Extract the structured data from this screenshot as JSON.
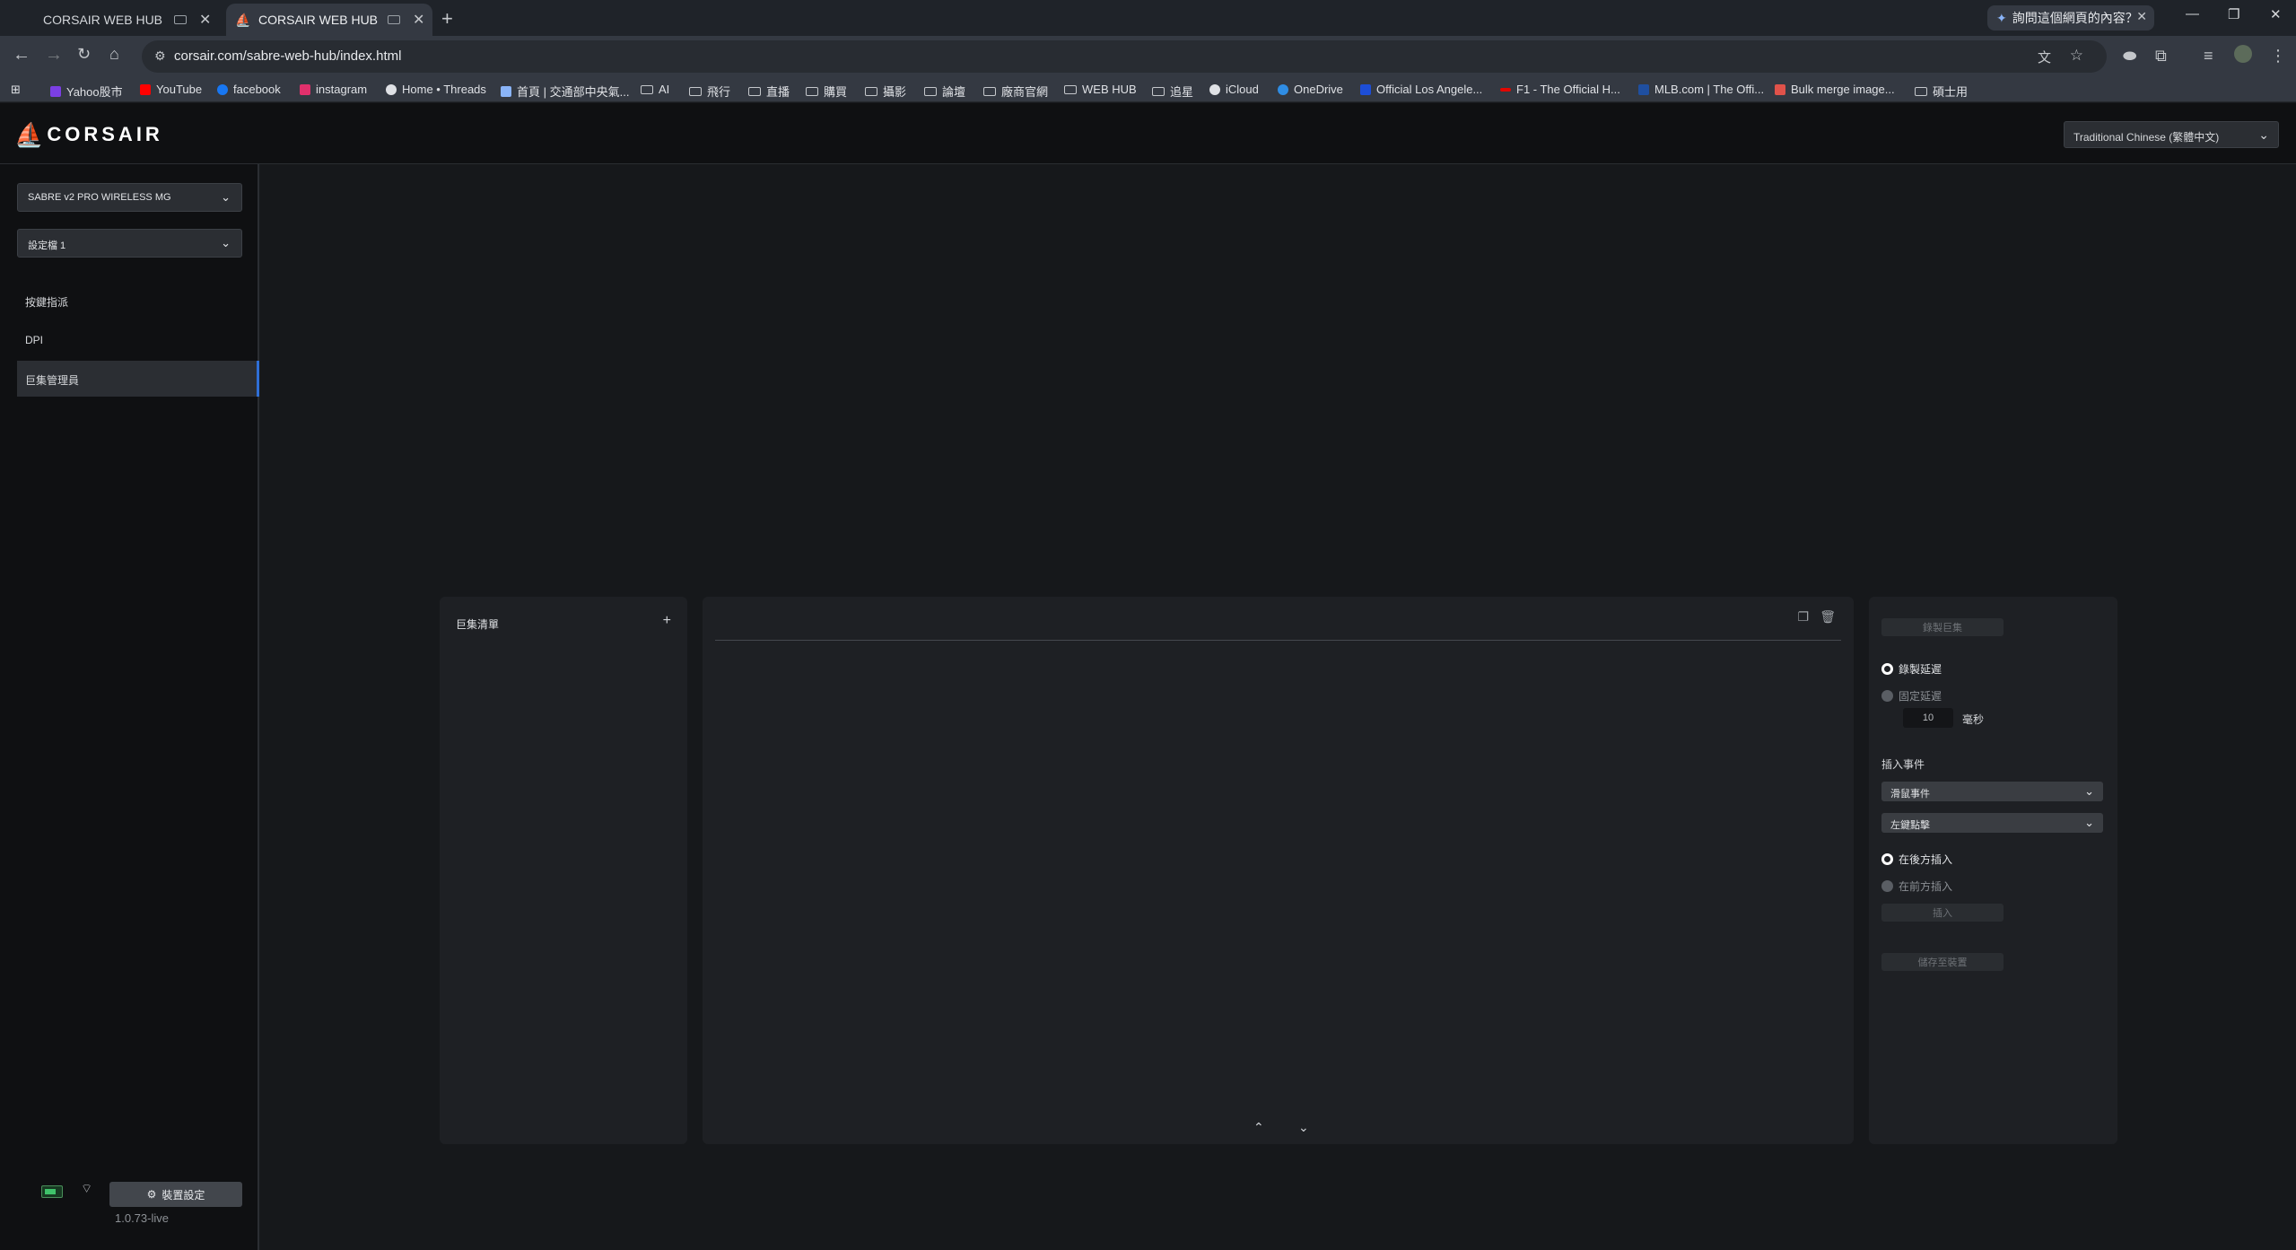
{
  "browser": {
    "tabs": [
      {
        "title": "CORSAIR WEB HUB",
        "active": false
      },
      {
        "title": "CORSAIR WEB HUB",
        "active": true
      }
    ],
    "ask_label": "詢問這個網頁的內容？",
    "url": "corsair.com/sabre-web-hub/index.html",
    "bookmarks": [
      {
        "label": "Yahoo股市",
        "icon": "yahoo-icon",
        "color": "#7b3fe4"
      },
      {
        "label": "YouTube",
        "icon": "youtube-icon",
        "color": "#ff0000"
      },
      {
        "label": "facebook",
        "icon": "facebook-icon",
        "color": "#1877f2"
      },
      {
        "label": "instagram",
        "icon": "instagram-icon",
        "color": "#e1306c"
      },
      {
        "label": "Home • Threads",
        "icon": "threads-icon",
        "color": "#ffffff"
      },
      {
        "label": "首頁 | 交通部中央氣...",
        "icon": "cwa-icon",
        "color": "#8ab4f8"
      },
      {
        "label": "AI",
        "icon": "folder-icon"
      },
      {
        "label": "飛行",
        "icon": "folder-icon"
      },
      {
        "label": "直播",
        "icon": "folder-icon"
      },
      {
        "label": "購買",
        "icon": "folder-icon"
      },
      {
        "label": "攝影",
        "icon": "folder-icon"
      },
      {
        "label": "論壇",
        "icon": "folder-icon"
      },
      {
        "label": "廠商官網",
        "icon": "folder-icon"
      },
      {
        "label": "WEB HUB",
        "icon": "folder-icon"
      },
      {
        "label": "追星",
        "icon": "folder-icon"
      },
      {
        "label": "iCloud",
        "icon": "icloud-icon",
        "color": "#dfe1e5"
      },
      {
        "label": "OneDrive",
        "icon": "onedrive-icon",
        "color": "#2f8de4"
      },
      {
        "label": "Official Los Angele...",
        "icon": "dodgers-icon",
        "color": "#1d4ed8"
      },
      {
        "label": "F1 - The Official H...",
        "icon": "f1-icon",
        "color": "#e10600"
      },
      {
        "label": "MLB.com | The Offi...",
        "icon": "mlb-icon",
        "color": "#1f4fa0"
      },
      {
        "label": "Bulk merge image...",
        "icon": "merge-icon",
        "color": "#e0524a"
      },
      {
        "label": "碩士用",
        "icon": "folder-icon"
      }
    ]
  },
  "app": {
    "brand": "CORSAIR",
    "language": "Traditional Chinese (繁體中文)",
    "device": "SABRE v2 PRO WIRELESS MG",
    "profile": "設定檔 1",
    "nav": [
      {
        "label": "按鍵指派",
        "active": false
      },
      {
        "label": "DPI",
        "active": false
      },
      {
        "label": "巨集管理員",
        "active": true
      }
    ],
    "device_settings": "裝置設定",
    "version": "1.0.73-live",
    "battery_color": "#3fc36a",
    "accent": "#2f6fd6"
  },
  "macro": {
    "list_title": "巨集清單",
    "record_btn": "錄製巨集",
    "record_delay": "錄製延遲",
    "fixed_delay": "固定延遲",
    "delay_value": "10",
    "delay_unit": "毫秒",
    "insert_event_title": "插入事件",
    "event_type": "滑鼠事件",
    "event_action": "左鍵點擊",
    "insert_after": "在後方插入",
    "insert_before": "在前方插入",
    "insert_btn": "插入",
    "save_btn": "儲存至裝置"
  }
}
